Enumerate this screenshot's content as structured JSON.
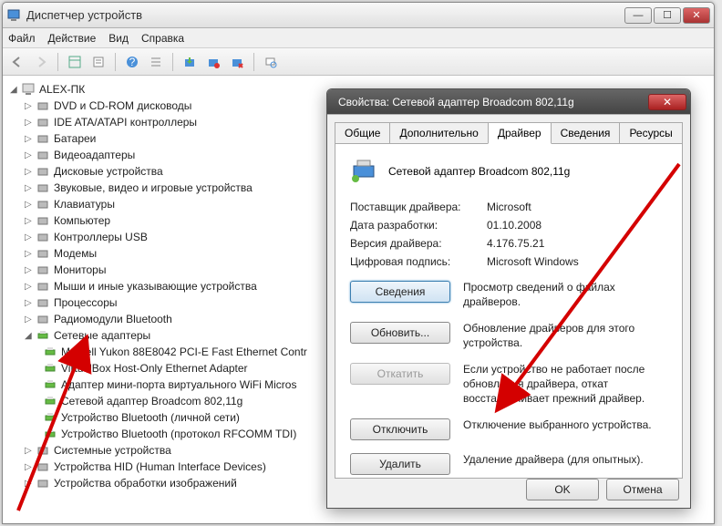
{
  "mainWindow": {
    "title": "Диспетчер устройств",
    "menu": {
      "file": "Файл",
      "action": "Действие",
      "view": "Вид",
      "help": "Справка"
    }
  },
  "tree": {
    "root": "ALEX-ПК",
    "items": [
      "DVD и CD-ROM дисководы",
      "IDE ATA/ATAPI контроллеры",
      "Батареи",
      "Видеоадаптеры",
      "Дисковые устройства",
      "Звуковые, видео и игровые устройства",
      "Клавиатуры",
      "Компьютер",
      "Контроллеры USB",
      "Модемы",
      "Мониторы",
      "Мыши и иные указывающие устройства",
      "Процессоры",
      "Радиомодули Bluetooth"
    ],
    "expanded": {
      "label": "Сетевые адаптеры",
      "children": [
        "Marvell Yukon 88E8042 PCI-E Fast Ethernet Contr",
        "VirtualBox Host-Only Ethernet Adapter",
        "Адаптер мини-порта виртуального WiFi Micros",
        "Сетевой адаптер Broadcom 802,11g",
        "Устройство Bluetooth (личной сети)",
        "Устройство Bluetooth (протокол RFCOMM TDI)"
      ]
    },
    "after": [
      "Системные устройства",
      "Устройства HID (Human Interface Devices)",
      "Устройства обработки изображений"
    ]
  },
  "dialog": {
    "title": "Свойства: Сетевой адаптер Broadcom 802,11g",
    "tabs": {
      "general": "Общие",
      "advanced": "Дополнительно",
      "driver": "Драйвер",
      "details": "Сведения",
      "resources": "Ресурсы"
    },
    "deviceName": "Сетевой адаптер Broadcom 802,11g",
    "info": {
      "vendor_label": "Поставщик драйвера:",
      "vendor_value": "Microsoft",
      "date_label": "Дата разработки:",
      "date_value": "01.10.2008",
      "version_label": "Версия драйвера:",
      "version_value": "4.176.75.21",
      "sig_label": "Цифровая подпись:",
      "sig_value": "Microsoft Windows"
    },
    "actions": {
      "details_btn": "Сведения",
      "details_desc": "Просмотр сведений о файлах драйверов.",
      "update_btn": "Обновить...",
      "update_desc": "Обновление драйверов для этого устройства.",
      "rollback_btn": "Откатить",
      "rollback_desc": "Если устройство не работает после обновления драйвера, откат восстанавливает прежний драйвер.",
      "disable_btn": "Отключить",
      "disable_desc": "Отключение выбранного устройства.",
      "delete_btn": "Удалить",
      "delete_desc": "Удаление драйвера (для опытных)."
    },
    "footer": {
      "ok": "OK",
      "cancel": "Отмена"
    }
  }
}
